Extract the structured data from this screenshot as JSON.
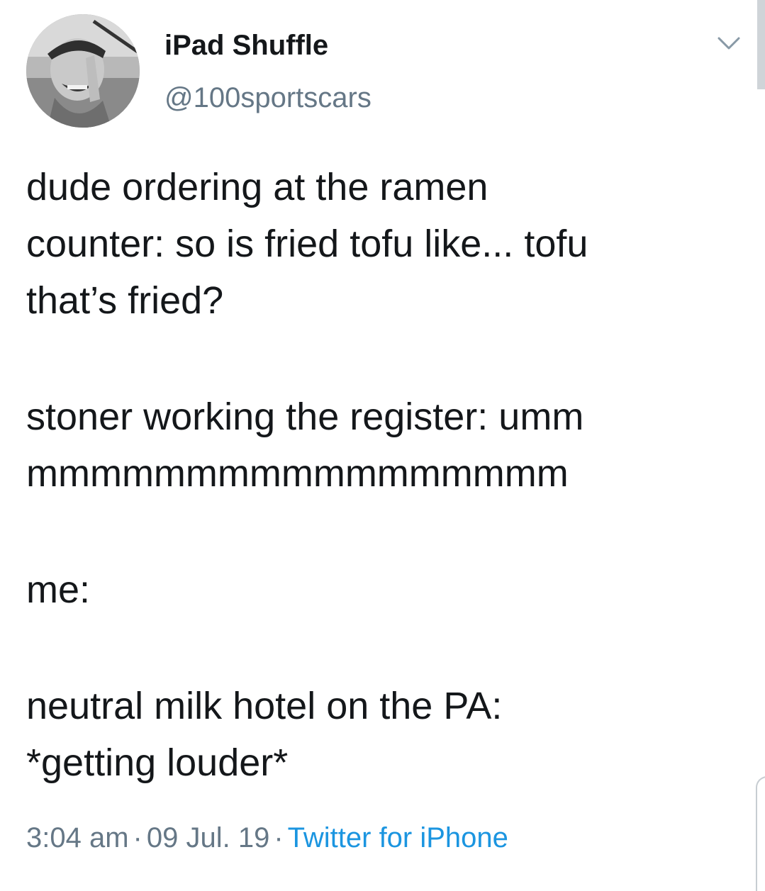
{
  "author": {
    "display_name": "iPad Shuffle",
    "handle": "@100sportscars"
  },
  "tweet": {
    "lines": [
      "dude ordering at the ramen",
      "counter: so is fried tofu like... tofu",
      "that’s fried?",
      "stoner working the register: umm",
      "mmmmmmmmmmmmmmmmm",
      "me:",
      "neutral milk hotel on the PA:",
      "*getting louder*"
    ]
  },
  "meta": {
    "time": "3:04 am",
    "separator": "·",
    "date": "09 Jul. 19",
    "source": "Twitter for iPhone"
  },
  "icons": {
    "menu": "chevron-down-icon",
    "avatar": "profile-photo"
  },
  "colors": {
    "text": "#14171a",
    "secondary": "#657786",
    "link": "#1b95e0",
    "background": "#ffffff"
  }
}
